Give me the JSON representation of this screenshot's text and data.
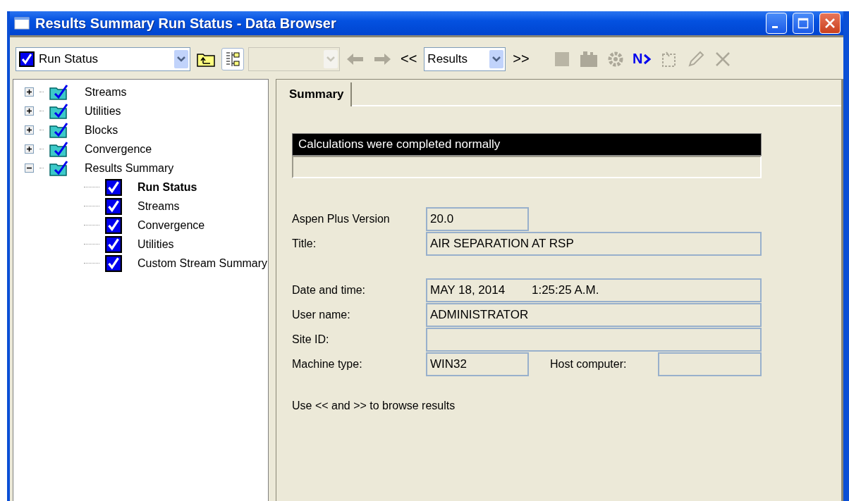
{
  "window": {
    "title": "Results Summary Run Status - Data Browser"
  },
  "toolbar": {
    "form_select": {
      "value": "Run Status",
      "checked": true
    },
    "id_select": {
      "disabled": true
    },
    "prev_label": "<<",
    "next_label": ">>",
    "sheet_select": {
      "value": "Results"
    },
    "buttons": [
      {
        "kind": "up-folder",
        "disabled": false
      },
      {
        "kind": "tree-toggle",
        "disabled": false,
        "selected": true
      },
      {
        "kind": "back",
        "disabled": true
      },
      {
        "kind": "forward",
        "disabled": true
      },
      {
        "kind": "sheet",
        "disabled": true
      },
      {
        "kind": "chart",
        "disabled": true
      },
      {
        "kind": "gear",
        "disabled": true
      },
      {
        "kind": "next",
        "disabled": false,
        "label": "N"
      },
      {
        "kind": "paste",
        "disabled": true
      },
      {
        "kind": "edit",
        "disabled": true
      },
      {
        "kind": "delete",
        "disabled": true
      }
    ]
  },
  "tree": [
    {
      "label": "Streams",
      "expanded": false,
      "selected": false
    },
    {
      "label": "Utilities",
      "expanded": false,
      "selected": false
    },
    {
      "label": "Blocks",
      "expanded": false,
      "selected": false
    },
    {
      "label": "Convergence",
      "expanded": false,
      "selected": false
    },
    {
      "label": "Results Summary",
      "expanded": true,
      "selected": false,
      "children": [
        {
          "label": "Run Status",
          "selected": true
        },
        {
          "label": "Streams",
          "selected": false
        },
        {
          "label": "Convergence",
          "selected": false
        },
        {
          "label": "Utilities",
          "selected": false
        },
        {
          "label": "Custom Stream Summary",
          "selected": false
        }
      ]
    }
  ],
  "tabs": [
    {
      "label": "Summary",
      "selected": true
    }
  ],
  "status_message": "Calculations were completed normally",
  "field_groups": [
    [
      {
        "label": "Aspen Plus Version",
        "value": "20.0",
        "kind": "short"
      },
      {
        "label": "Title:",
        "value": "AIR SEPARATION AT RSP",
        "kind": "wide"
      }
    ],
    [
      {
        "label": "Date and time:",
        "value": "MAY 18, 2014        1:25:25 A.M.",
        "kind": "wide"
      },
      {
        "label": "User name:",
        "value": "ADMINISTRATOR",
        "kind": "wide"
      },
      {
        "label": "Site ID:",
        "kind": "wide"
      },
      {
        "label": "Machine type:",
        "value": "WIN32",
        "kind": "pair",
        "second_label": "Host computer:"
      }
    ]
  ],
  "hint": "Use << and >> to browse results"
}
